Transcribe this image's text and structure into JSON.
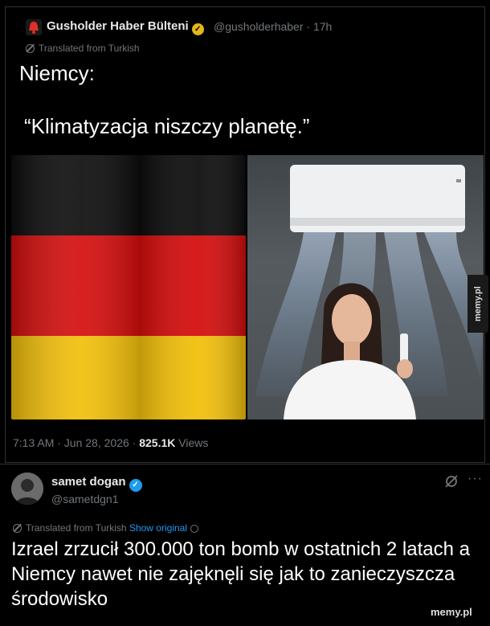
{
  "tweet1": {
    "display_name": "Gusholder Haber Bülteni",
    "handle_time": "@gusholderhaber · 17h",
    "translated": "Translated from Turkish",
    "text_line1": "Niemcy:",
    "text_line2": "“Klimatyzacja niszczy planetę.”",
    "timestamp": "7:13 AM · Jun 28, 2026 · ",
    "views_count": "825.1K",
    "views_label": " Views"
  },
  "tweet2": {
    "display_name": "samet dogan",
    "handle": "@sametdgn1",
    "translated": "Translated from Turkish",
    "show_original": "Show original",
    "text": "Izrael zrzucił 300.000 ton bomb w ostatnich 2 latach a Niemcy nawet nie zajęknęli się jak to zanieczyszcza środowisko",
    "more": "···"
  },
  "watermark": {
    "side": "memy.pl",
    "bottom": "memy.pl"
  },
  "colors": {
    "background": "#000000",
    "muted": "#71767b",
    "link": "#1d9bf0",
    "gold_badge": "#e2b719",
    "blue_badge": "#1d9bf0",
    "flag_black": "#000000",
    "flag_red": "#dd0000",
    "flag_gold": "#ffce00"
  }
}
